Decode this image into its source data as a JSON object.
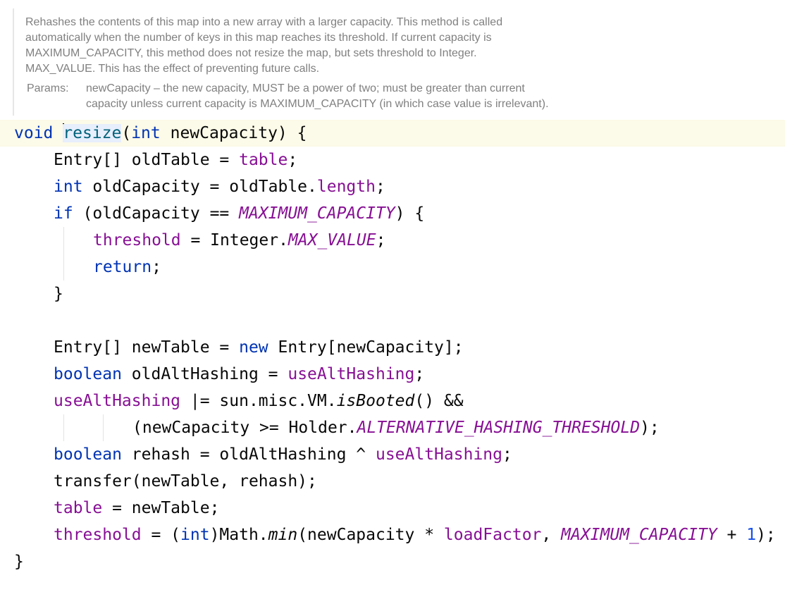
{
  "javadoc": {
    "description_lines": [
      "Rehashes the contents of this map into a new array with a larger capacity. This method is called",
      "automatically when the number of keys in this map reaches its threshold. If current capacity is",
      "MAXIMUM_CAPACITY, this method does not resize the map, but sets threshold to Integer.",
      "MAX_VALUE. This has the effect of preventing future calls."
    ],
    "params_label": "Params:",
    "param_lines": [
      "newCapacity – the new capacity, MUST be a power of two; must be greater than current",
      "capacity unless current capacity is MAXIMUM_CAPACITY (in which case value is irrelevant)."
    ]
  },
  "colors": {
    "keyword": "#0033b3",
    "field": "#871094",
    "number": "#1750eb",
    "declaration": "#00627a",
    "doc_text": "#808080",
    "current_line": "#fcfae8"
  },
  "code": {
    "current_line": 0,
    "lines": [
      {
        "indent": 0,
        "tokens": [
          {
            "t": "void",
            "c": "kw"
          },
          {
            "t": " ",
            "c": "pl"
          },
          {
            "caret": true
          },
          {
            "t": "resize",
            "c": "decl"
          },
          {
            "t": "(",
            "c": "pl"
          },
          {
            "t": "int",
            "c": "kw"
          },
          {
            "t": " newCapacity) {",
            "c": "pl"
          }
        ]
      },
      {
        "indent": 1,
        "tokens": [
          {
            "t": "Entry[] oldTable = ",
            "c": "pl"
          },
          {
            "t": "table",
            "c": "fld"
          },
          {
            "t": ";",
            "c": "pl"
          }
        ]
      },
      {
        "indent": 1,
        "tokens": [
          {
            "t": "int",
            "c": "kw"
          },
          {
            "t": " oldCapacity = oldTable.",
            "c": "pl"
          },
          {
            "t": "length",
            "c": "fld"
          },
          {
            "t": ";",
            "c": "pl"
          }
        ]
      },
      {
        "indent": 1,
        "tokens": [
          {
            "t": "if",
            "c": "kw"
          },
          {
            "t": " (oldCapacity == ",
            "c": "pl"
          },
          {
            "t": "MAXIMUM_CAPACITY",
            "c": "cst"
          },
          {
            "t": ") {",
            "c": "pl"
          }
        ]
      },
      {
        "indent": 2,
        "tokens": [
          {
            "t": "threshold",
            "c": "fld"
          },
          {
            "t": " = Integer.",
            "c": "pl"
          },
          {
            "t": "MAX_VALUE",
            "c": "cst"
          },
          {
            "t": ";",
            "c": "pl"
          }
        ]
      },
      {
        "indent": 2,
        "tokens": [
          {
            "t": "return",
            "c": "kw"
          },
          {
            "t": ";",
            "c": "pl"
          }
        ]
      },
      {
        "indent": 1,
        "tokens": [
          {
            "t": "}",
            "c": "pl"
          }
        ]
      },
      {
        "indent": 0,
        "tokens": []
      },
      {
        "indent": 1,
        "tokens": [
          {
            "t": "Entry[] newTable = ",
            "c": "pl"
          },
          {
            "t": "new",
            "c": "kw"
          },
          {
            "t": " Entry[newCapacity];",
            "c": "pl"
          }
        ]
      },
      {
        "indent": 1,
        "tokens": [
          {
            "t": "boolean",
            "c": "kw"
          },
          {
            "t": " oldAltHashing = ",
            "c": "pl"
          },
          {
            "t": "useAltHashing",
            "c": "fld"
          },
          {
            "t": ";",
            "c": "pl"
          }
        ]
      },
      {
        "indent": 1,
        "tokens": [
          {
            "t": "useAltHashing",
            "c": "fld"
          },
          {
            "t": " |= sun.misc.VM.",
            "c": "pl"
          },
          {
            "t": "isBooted",
            "c": "mth"
          },
          {
            "t": "() &&",
            "c": "pl"
          }
        ]
      },
      {
        "indent": 3,
        "tokens": [
          {
            "t": "(newCapacity >= Holder.",
            "c": "pl"
          },
          {
            "t": "ALTERNATIVE_HASHING_THRESHOLD",
            "c": "cst"
          },
          {
            "t": ");",
            "c": "pl"
          }
        ]
      },
      {
        "indent": 1,
        "tokens": [
          {
            "t": "boolean",
            "c": "kw"
          },
          {
            "t": " rehash = oldAltHashing ^ ",
            "c": "pl"
          },
          {
            "t": "useAltHashing",
            "c": "fld"
          },
          {
            "t": ";",
            "c": "pl"
          }
        ]
      },
      {
        "indent": 1,
        "tokens": [
          {
            "t": "transfer(newTable, rehash);",
            "c": "pl"
          }
        ]
      },
      {
        "indent": 1,
        "tokens": [
          {
            "t": "table",
            "c": "fld"
          },
          {
            "t": " = newTable;",
            "c": "pl"
          }
        ]
      },
      {
        "indent": 1,
        "tokens": [
          {
            "t": "threshold",
            "c": "fld"
          },
          {
            "t": " = (",
            "c": "pl"
          },
          {
            "t": "int",
            "c": "kw"
          },
          {
            "t": ")Math.",
            "c": "pl"
          },
          {
            "t": "min",
            "c": "mth"
          },
          {
            "t": "(newCapacity * ",
            "c": "pl"
          },
          {
            "t": "loadFactor",
            "c": "fld"
          },
          {
            "t": ", ",
            "c": "pl"
          },
          {
            "t": "MAXIMUM_CAPACITY",
            "c": "cst"
          },
          {
            "t": " + ",
            "c": "pl"
          },
          {
            "t": "1",
            "c": "num"
          },
          {
            "t": ");",
            "c": "pl"
          }
        ]
      },
      {
        "indent": 0,
        "tokens": [
          {
            "t": "}",
            "c": "pl"
          }
        ]
      }
    ]
  }
}
